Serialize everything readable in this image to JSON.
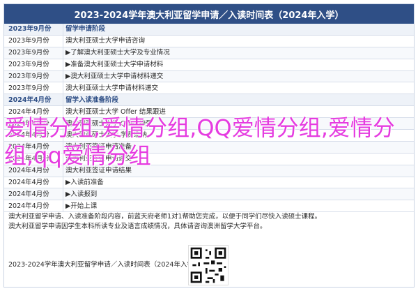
{
  "title": "2023-2024学年澳大利亚留学申请／入读时间表（2024年入学）",
  "rows": [
    {
      "type": "sec",
      "date": "2023年9月份",
      "text": "留学申请阶段"
    },
    {
      "type": "row",
      "date": "2023年9月份",
      "text": "澳大利亚硕士大学申请咨询"
    },
    {
      "type": "row",
      "date": "2023年9月份",
      "text": "▶了解澳大利亚硕士大学及专业情况"
    },
    {
      "type": "row",
      "date": "2023年9月份",
      "text": "▶准备澳大利亚硕士大学申请材料"
    },
    {
      "type": "row",
      "date": "2023年9月份",
      "text": "▶澳大利亚硕士大学申请材料递交"
    },
    {
      "type": "row",
      "date": "2023年9月份",
      "text": "澳大利亚硕士大学申请材料递交"
    },
    {
      "type": "sec",
      "date": "2024年4月份",
      "text": "留学入读准备阶段"
    },
    {
      "type": "row",
      "date": "2024年4月份",
      "text": "澳大利亚硕士大学 Offer 结果跟进"
    },
    {
      "type": "row",
      "date": "2024年4月份",
      "text": "澳大利亚硕士大学 Offer 接受"
    },
    {
      "type": "row",
      "date": "2024年4月份",
      "text": "澳大利亚硕士大学 学费缴纳"
    },
    {
      "type": "row",
      "date": "2024年4月份",
      "text": "澳大利亚签证申请准备"
    },
    {
      "type": "row",
      "date": "2024年4月份",
      "text": "澳大利亚签证申请递交"
    },
    {
      "type": "row",
      "date": "2024年4月份",
      "text": "澳大利亚签证申请结果"
    },
    {
      "type": "row",
      "date": "2024年4月份",
      "text": "▶入读前准备"
    },
    {
      "type": "row",
      "date": "2024年4月份",
      "text": "▶入读报到"
    },
    {
      "type": "row",
      "date": "2024年4月份",
      "text": "▶开始上课"
    }
  ],
  "overlay": "爱情分组,爱情分组,QQ爱情分组,爱情分组,qq爱情分组",
  "notes": [
    "澳大利亚留学申请、入读准备阶段内容，前蓝天府老师1对1帮助您完成，以便于同学们尽快入读硕士课程。",
    "澳大利亚留学申请因学生本科所读专业及语言成绩情况，具体请咨询澳洲留学大学平台。"
  ],
  "footer": "2023-2024学年澳大利亚留学申请／入读时间表（2024年入学）"
}
